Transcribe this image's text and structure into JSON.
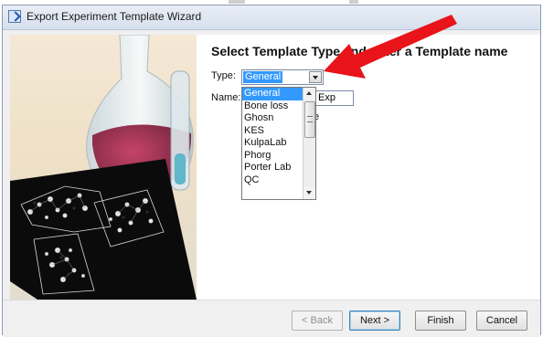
{
  "window": {
    "title": "Export Experiment Template Wizard"
  },
  "content": {
    "heading": "Select Template Type and enter a Template name",
    "type_label": "Type:",
    "type_value": "General",
    "name_label": "Name:",
    "name_value": "Exp",
    "partial_text": "e"
  },
  "dropdown": {
    "options": [
      "General",
      "Bone loss",
      "Ghosn",
      "KES",
      "KulpaLab",
      "Phorg",
      "Porter Lab",
      "QC"
    ],
    "selected_index": 0
  },
  "buttons": {
    "back": "< Back",
    "next": "Next >",
    "finish": "Finish",
    "cancel": "Cancel"
  },
  "colors": {
    "selection": "#3399ff",
    "arrow": "#e8141a"
  }
}
